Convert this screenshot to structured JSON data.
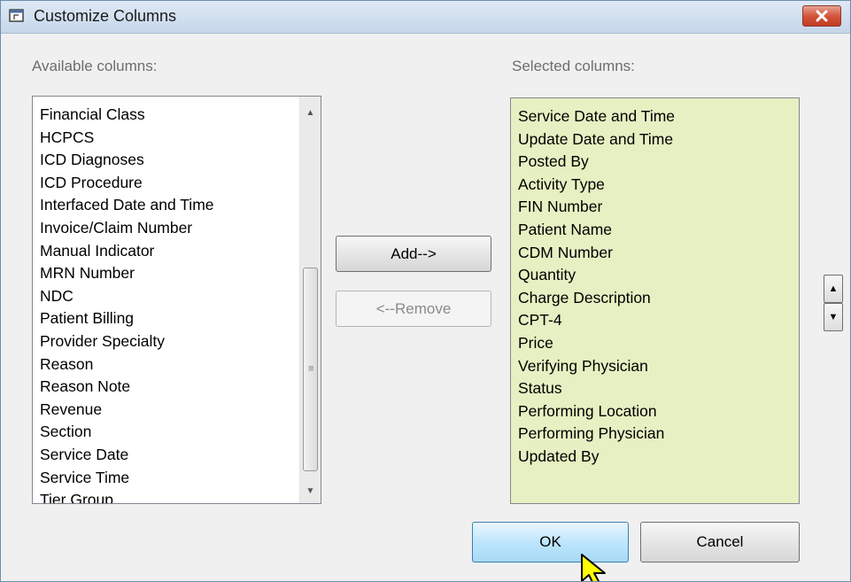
{
  "window": {
    "title": "Customize Columns",
    "icons": {
      "app": "window-icon",
      "close": "close-icon"
    }
  },
  "available": {
    "label": "Available columns:",
    "items": [
      "Financial Class",
      "HCPCS",
      "ICD Diagnoses",
      "ICD Procedure",
      "Interfaced Date and Time",
      "Invoice/Claim Number",
      "Manual Indicator",
      "MRN Number",
      "NDC",
      "Patient Billing",
      "Provider Specialty",
      "Reason",
      "Reason Note",
      "Revenue",
      "Section",
      "Service Date",
      "Service Time",
      "Tier Group"
    ]
  },
  "selected": {
    "label": "Selected columns:",
    "background": "#e6f0c2",
    "items": [
      "Service Date and Time",
      "Update Date and Time",
      "Posted By",
      "Activity Type",
      "FIN Number",
      "Patient Name",
      "CDM Number",
      "Quantity",
      "Charge Description",
      "CPT-4",
      "Price",
      "Verifying Physician",
      "Status",
      "Performing Location",
      "Performing Physician",
      "Updated By"
    ]
  },
  "buttons": {
    "add": "Add-->",
    "remove": "<--Remove",
    "ok": "OK",
    "cancel": "Cancel",
    "remove_enabled": false
  },
  "order": {
    "up_icon": "move-up-icon",
    "down_icon": "move-down-icon"
  },
  "cursor": {
    "icon": "pointer-cursor-icon",
    "color": "#ffff00"
  }
}
